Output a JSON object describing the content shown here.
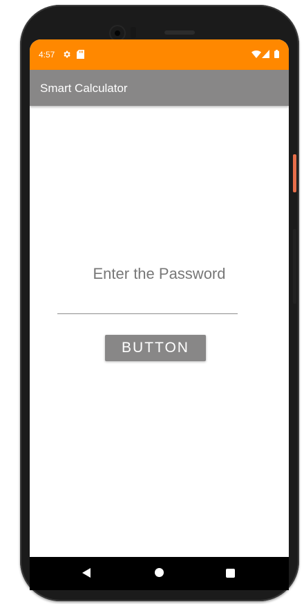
{
  "status_bar": {
    "time": "4:57",
    "background": "#ff8800",
    "icons": [
      "settings-gear-icon",
      "sd-card-icon",
      "wifi-icon",
      "cell-signal-icon",
      "battery-icon"
    ]
  },
  "app_bar": {
    "title": "Smart Calculator",
    "background": "#888787"
  },
  "main": {
    "prompt": "Enter the Password",
    "password_value": "",
    "button_label": "BUTTON"
  },
  "nav_bar": {
    "icons": [
      "back-icon",
      "home-icon",
      "recents-icon"
    ]
  }
}
